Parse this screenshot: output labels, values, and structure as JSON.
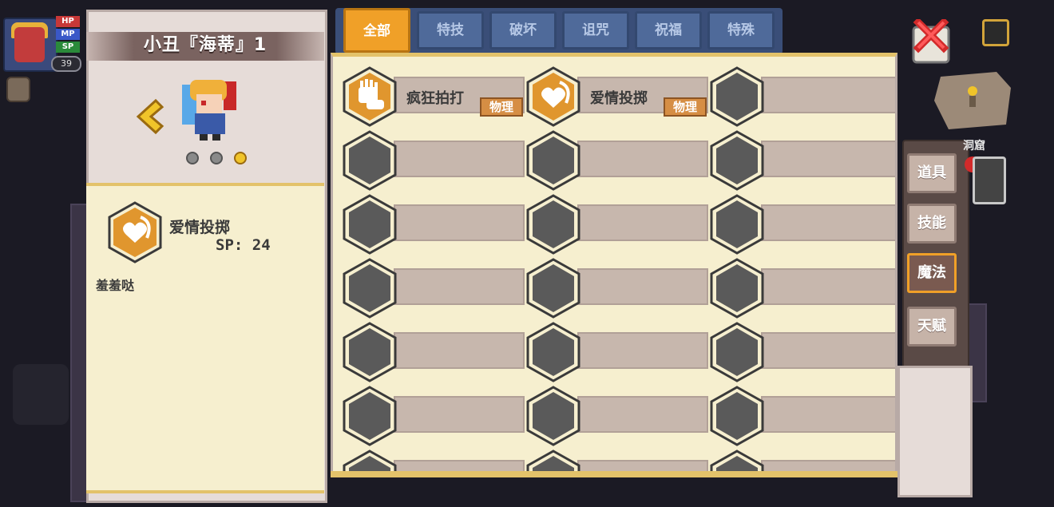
{
  "hud": {
    "bars": [
      "HP",
      "MP",
      "SP"
    ],
    "level": "39"
  },
  "character": {
    "name": "小丑『海蒂』1",
    "page_dots": [
      false,
      false,
      true
    ]
  },
  "detail": {
    "skill_name": "爱情投掷",
    "sp_cost": "SP: 24",
    "description": "羞羞哒"
  },
  "tabs": [
    {
      "label": "全部",
      "active": true
    },
    {
      "label": "特技",
      "active": false
    },
    {
      "label": "破坏",
      "active": false
    },
    {
      "label": "诅咒",
      "active": false
    },
    {
      "label": "祝福",
      "active": false
    },
    {
      "label": "特殊",
      "active": false
    }
  ],
  "skills": [
    {
      "name": "疯狂拍打",
      "tag": "物理",
      "icon": "slap-hand-icon"
    },
    {
      "name": "爱情投掷",
      "tag": "物理",
      "icon": "heart-throw-icon"
    }
  ],
  "side_menu": [
    {
      "label": "道具",
      "active": false
    },
    {
      "label": "技能",
      "active": false
    },
    {
      "label": "魔法",
      "active": true
    },
    {
      "label": "天赋",
      "active": false
    }
  ],
  "map_label": "洞窟",
  "colors": {
    "accent": "#f0a028",
    "tab_inactive": "#4f6a9a",
    "panel_bg": "#f6efcf",
    "tag_bg": "#d68e44"
  }
}
